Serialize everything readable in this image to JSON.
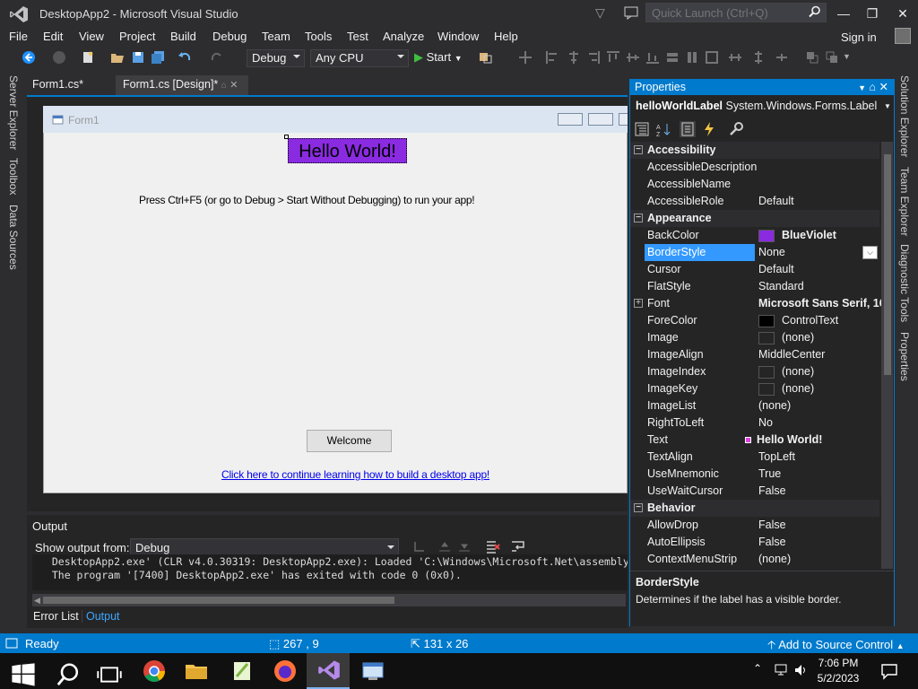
{
  "window": {
    "title": "DesktopApp2 - Microsoft Visual Studio",
    "quick_launch_placeholder": "Quick Launch (Ctrl+Q)"
  },
  "menu": [
    "File",
    "Edit",
    "View",
    "Project",
    "Build",
    "Debug",
    "Team",
    "Tools",
    "Test",
    "Analyze",
    "Window",
    "Help"
  ],
  "signin": "Sign in",
  "toolbar": {
    "config": "Debug",
    "platform": "Any CPU",
    "start": "Start"
  },
  "left_rail": [
    "Server Explorer",
    "Toolbox",
    "Data Sources"
  ],
  "right_rail": [
    "Solution Explorer",
    "Team Explorer",
    "Diagnostic Tools",
    "Properties"
  ],
  "doc_tabs": [
    "Form1.cs*",
    "Form1.cs [Design]*"
  ],
  "form": {
    "title": "Form1",
    "hello": "Hello World!",
    "press": "Press Ctrl+F5 (or go to Debug > Start Without Debugging) to run your app!",
    "welcome": "Welcome",
    "link": "Click here to continue learning how to build a desktop app!"
  },
  "output": {
    "title": "Output",
    "show_from": "Show output from:",
    "source": "Debug",
    "lines": [
      "  DesktopApp2.exe' (CLR v4.0.30319: DesktopApp2.exe): Loaded 'C:\\Windows\\Microsoft.Net\\assembly",
      "  The program '[7400] DesktopApp2.exe' has exited with code 0 (0x0)."
    ]
  },
  "bottom_tabs": [
    "Error List",
    "Output"
  ],
  "properties": {
    "title": "Properties",
    "object_name": "helloWorldLabel",
    "object_type": "System.Windows.Forms.Label",
    "rows": [
      {
        "cat": "Accessibility"
      },
      {
        "name": "AccessibleDescription",
        "value": ""
      },
      {
        "name": "AccessibleName",
        "value": ""
      },
      {
        "name": "AccessibleRole",
        "value": "Default"
      },
      {
        "cat": "Appearance"
      },
      {
        "name": "BackColor",
        "value": "BlueViolet",
        "swatch": "#8a2be2",
        "bold": true
      },
      {
        "name": "BorderStyle",
        "value": "None",
        "selected": true
      },
      {
        "name": "Cursor",
        "value": "Default"
      },
      {
        "name": "FlatStyle",
        "value": "Standard"
      },
      {
        "name": "Font",
        "value": "Microsoft Sans Serif, 16pt",
        "bold": true,
        "expand": true
      },
      {
        "name": "ForeColor",
        "value": "ControlText",
        "swatch": "#000000"
      },
      {
        "name": "Image",
        "value": "(none)",
        "swatch": "#252526"
      },
      {
        "name": "ImageAlign",
        "value": "MiddleCenter"
      },
      {
        "name": "ImageIndex",
        "value": "(none)",
        "swatch": "#252526"
      },
      {
        "name": "ImageKey",
        "value": "(none)",
        "swatch": "#252526"
      },
      {
        "name": "ImageList",
        "value": "(none)"
      },
      {
        "name": "RightToLeft",
        "value": "No"
      },
      {
        "name": "Text",
        "value": "Hello World!",
        "bold": true,
        "mark": true
      },
      {
        "name": "TextAlign",
        "value": "TopLeft"
      },
      {
        "name": "UseMnemonic",
        "value": "True"
      },
      {
        "name": "UseWaitCursor",
        "value": "False"
      },
      {
        "cat": "Behavior"
      },
      {
        "name": "AllowDrop",
        "value": "False"
      },
      {
        "name": "AutoEllipsis",
        "value": "False"
      },
      {
        "name": "ContextMenuStrip",
        "value": "(none)"
      }
    ],
    "desc_name": "BorderStyle",
    "desc_text": "Determines if the label has a visible border."
  },
  "status": {
    "ready": "Ready",
    "pos": "267 , 9",
    "size": "131 x 26",
    "source_control": "Add to Source Control"
  },
  "clock": {
    "time": "7:06 PM",
    "date": "5/2/2023"
  }
}
